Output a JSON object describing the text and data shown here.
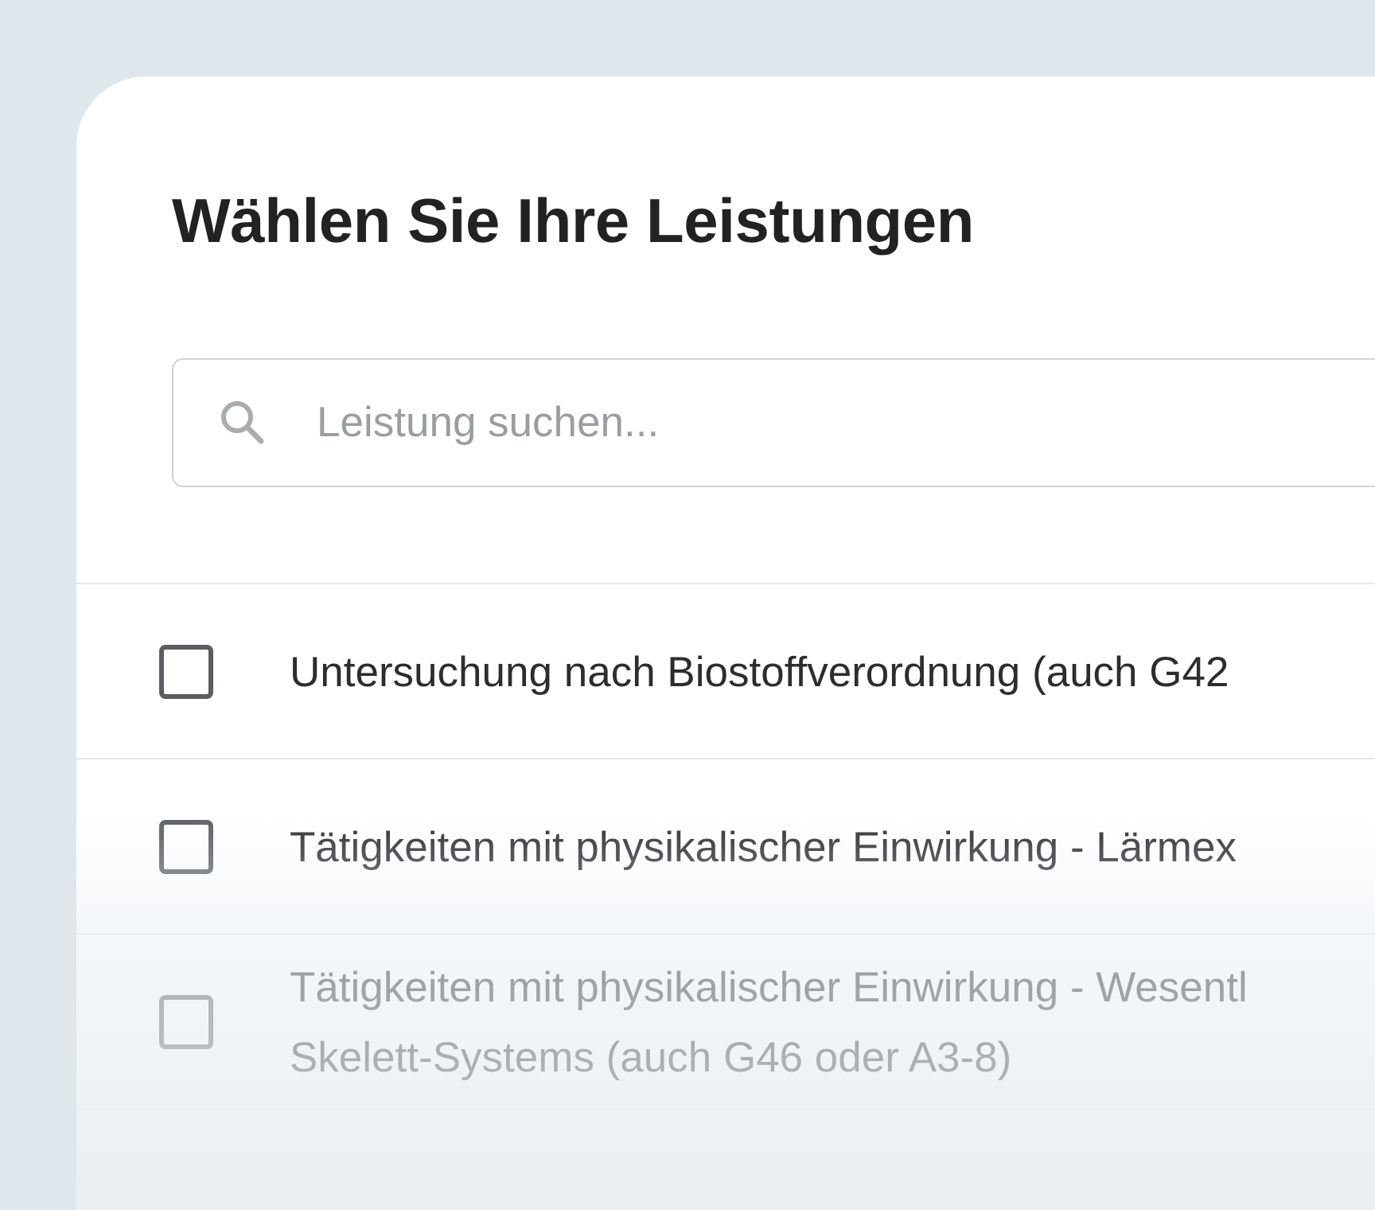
{
  "title": "Wählen Sie Ihre Leistungen",
  "search": {
    "placeholder": "Leistung suchen..."
  },
  "items": [
    {
      "lines": [
        "Untersuchung nach Biostoffverordnung (auch G42"
      ],
      "checked": false
    },
    {
      "lines": [
        "Tätigkeiten mit physikalischer Einwirkung - Lärmex"
      ],
      "checked": false
    },
    {
      "lines": [
        "Tätigkeiten mit physikalischer Einwirkung - Wesentl",
        "Skelett-Systems (auch G46 oder A3-8)"
      ],
      "checked": false
    }
  ]
}
